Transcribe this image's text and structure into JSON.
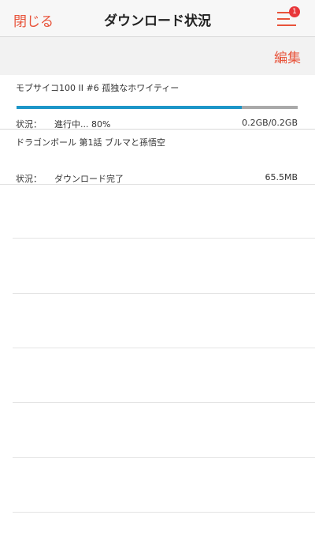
{
  "navbar": {
    "close_label": "閉じる",
    "title": "ダウンロード状況",
    "menu_badge": "1"
  },
  "toolbar": {
    "edit_label": "編集"
  },
  "downloads": [
    {
      "title": "モブサイコ100 II #6 孤独なホワイティー",
      "status_label": "状況：",
      "status_value": "進行中... 80%",
      "progress": 0.8,
      "size": "0.2GB/0.2GB"
    },
    {
      "title": "ドラゴンボール 第1話 ブルマと孫悟空",
      "status_label": "状況：",
      "status_value": "ダウンロード完了",
      "size": "65.5MB"
    }
  ],
  "colors": {
    "accent": "#e8533a",
    "progress_fill": "#1d96c8",
    "progress_track": "#a9a9a9",
    "badge": "#e8363a"
  }
}
